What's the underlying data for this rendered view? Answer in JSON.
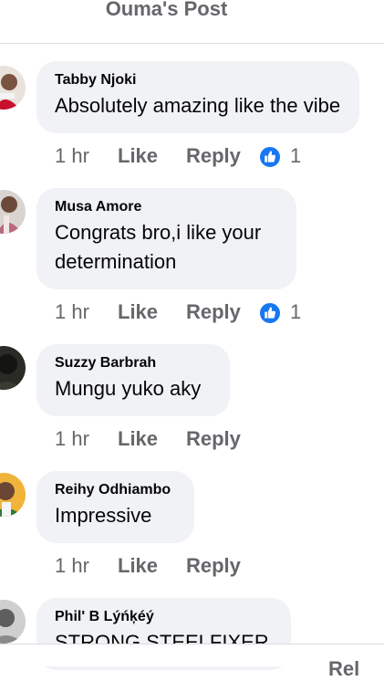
{
  "header": {
    "title": "Ouma's Post"
  },
  "comments": [
    {
      "author": "Tabby Njoki",
      "text": "Absolutely amazing like the vibe",
      "time": "1 hr",
      "like": "Like",
      "reply": "Reply",
      "reactions": "1"
    },
    {
      "author": "Musa Amore",
      "text1": "Congrats bro,i like your",
      "text2": "determination",
      "time": "1 hr",
      "like": "Like",
      "reply": "Reply",
      "reactions": "1"
    },
    {
      "author": "Suzzy Barbrah",
      "text": "Mungu yuko aky",
      "time": "1 hr",
      "like": "Like",
      "reply": "Reply"
    },
    {
      "author": "Reihy Odhiambo",
      "text": "Impressive",
      "time": "1 hr",
      "like": "Like",
      "reply": "Reply"
    },
    {
      "author": "Phil' B Lýńķéý",
      "text": "STRONG STEELFIXER"
    }
  ],
  "footer": {
    "label": "Rel"
  },
  "colors": {
    "bubble": "#f0f2f5",
    "secondary_text": "#65676b",
    "like_blue": "#1877f2"
  }
}
